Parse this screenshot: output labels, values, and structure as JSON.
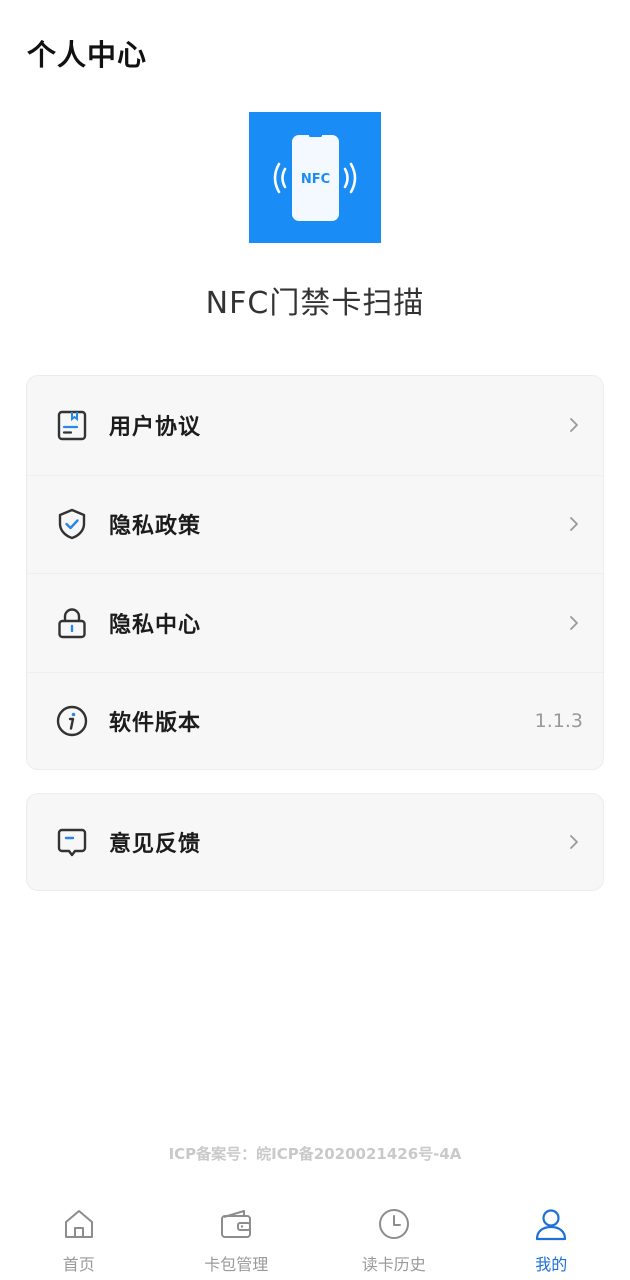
{
  "header": {
    "title": "个人中心"
  },
  "app": {
    "name": "NFC门禁卡扫描",
    "logo_text": "NFC"
  },
  "menu": {
    "items": [
      {
        "label": "用户协议",
        "icon": "document-icon"
      },
      {
        "label": "隐私政策",
        "icon": "shield-check-icon"
      },
      {
        "label": "隐私中心",
        "icon": "lock-icon"
      },
      {
        "label": "软件版本",
        "icon": "info-icon",
        "value": "1.1.3"
      }
    ],
    "feedback": {
      "label": "意见反馈",
      "icon": "message-icon"
    }
  },
  "footer": {
    "icp": "ICP备案号：皖ICP备2020021426号-4A"
  },
  "tabbar": {
    "tabs": [
      {
        "label": "首页",
        "icon": "home-icon"
      },
      {
        "label": "卡包管理",
        "icon": "wallet-icon"
      },
      {
        "label": "读卡历史",
        "icon": "clock-icon"
      },
      {
        "label": "我的",
        "icon": "user-icon",
        "active": true
      }
    ]
  },
  "colors": {
    "accent": "#1f6fd8",
    "logo_bg": "#1a8cf5",
    "check": "#2a86e8"
  }
}
